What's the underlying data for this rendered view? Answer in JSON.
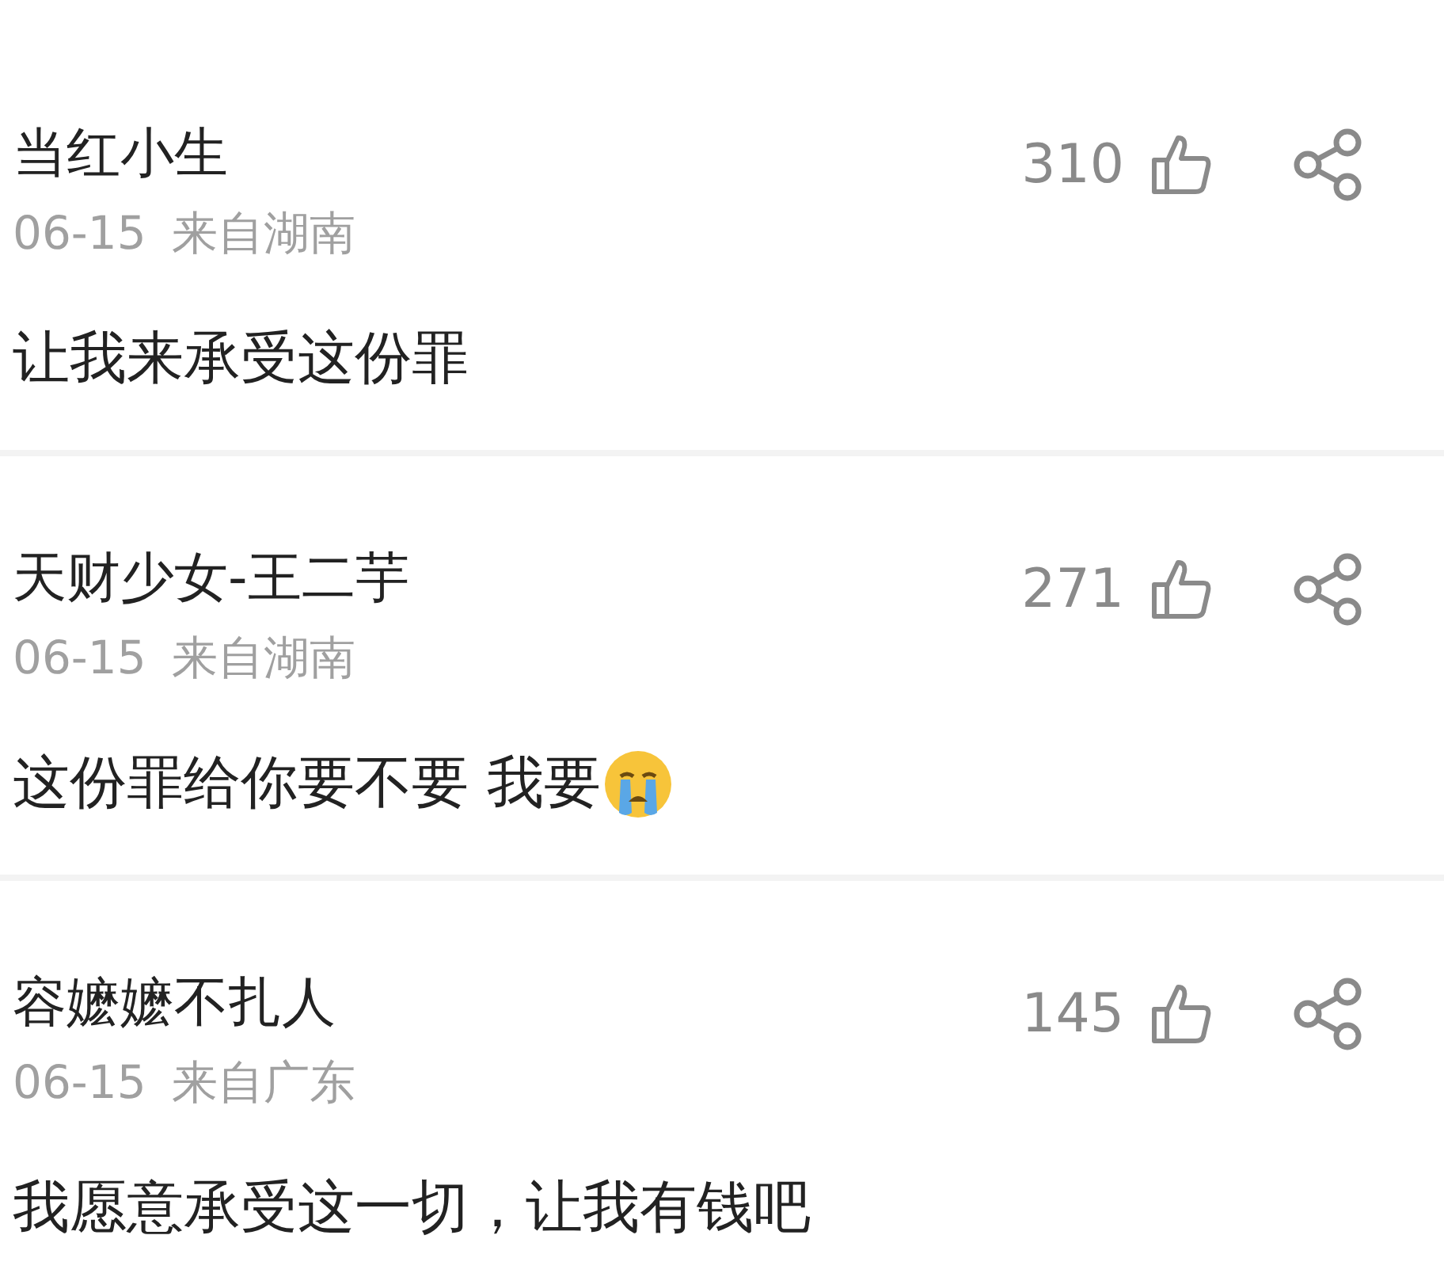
{
  "comments": [
    {
      "name": "当红小生",
      "date": "06-15",
      "location": "来自湖南",
      "likes": "310",
      "text": "让我来承受这份罪",
      "emoji": false
    },
    {
      "name": "天财少女-王二芋",
      "date": "06-15",
      "location": "来自湖南",
      "likes": "271",
      "text": "这份罪给你要不要 我要",
      "emoji": true
    },
    {
      "name": "容嬷嬷不扎人",
      "date": "06-15",
      "location": "来自广东",
      "likes": "145",
      "text": "我愿意承受这一切，让我有钱吧",
      "emoji": false
    }
  ]
}
